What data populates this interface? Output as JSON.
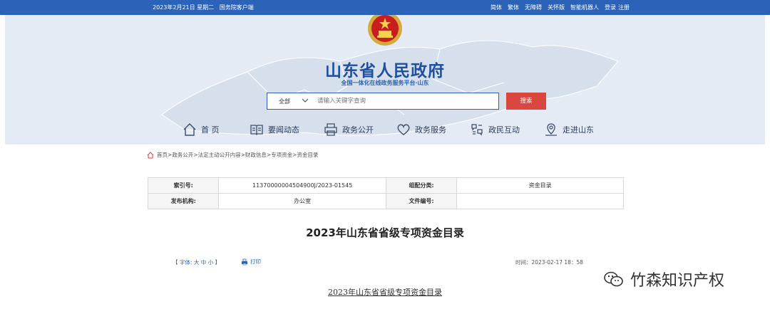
{
  "topbar": {
    "date": "2023年2月21日 星期二",
    "client": "国务院客户端",
    "links": [
      "简体",
      "繁体",
      "无障碍",
      "关怀版",
      "智能机器人",
      "登录",
      "注册"
    ]
  },
  "header": {
    "title": "山东省人民政府",
    "subtitle": "全国一体化在线政务服务平台·山东"
  },
  "search": {
    "scope": "全部",
    "placeholder": "请输入关键字查询",
    "button": "搜索"
  },
  "nav": {
    "items": [
      {
        "label": "首 页",
        "icon": "home-icon"
      },
      {
        "label": "要闻动态",
        "icon": "book-icon"
      },
      {
        "label": "政务公开",
        "icon": "printer-icon"
      },
      {
        "label": "政务服务",
        "icon": "heart-icon"
      },
      {
        "label": "政民互动",
        "icon": "interaction-icon"
      },
      {
        "label": "走进山东",
        "icon": "location-icon"
      }
    ]
  },
  "breadcrumb": "首页>政务公开>法定主动公开内容>财政信息>专项资金>资金目录",
  "meta": {
    "index_label": "索引号:",
    "index_value": "11370000004504900J/2023-01545",
    "category_label": "组配分类:",
    "category_value": "资金目录",
    "publisher_label": "发布机构:",
    "publisher_value": "办公室",
    "docno_label": "文件编号:",
    "docno_value": ""
  },
  "article": {
    "title": "2023年山东省省级专项资金目录",
    "font_label": "【 字体:",
    "font_large": "大",
    "font_medium": "中",
    "font_small": "小",
    "font_close": "】",
    "print": "打印",
    "time": "时间：2023-02-17 18：58",
    "subtitle": "2023年山东省省级专项资金目录"
  },
  "watermark": "竹森知识产权",
  "colors": {
    "primary": "#2a63b8",
    "title": "#1f4fa0",
    "search_button": "#d9473f",
    "banner_bg": "#e4ebf4"
  }
}
